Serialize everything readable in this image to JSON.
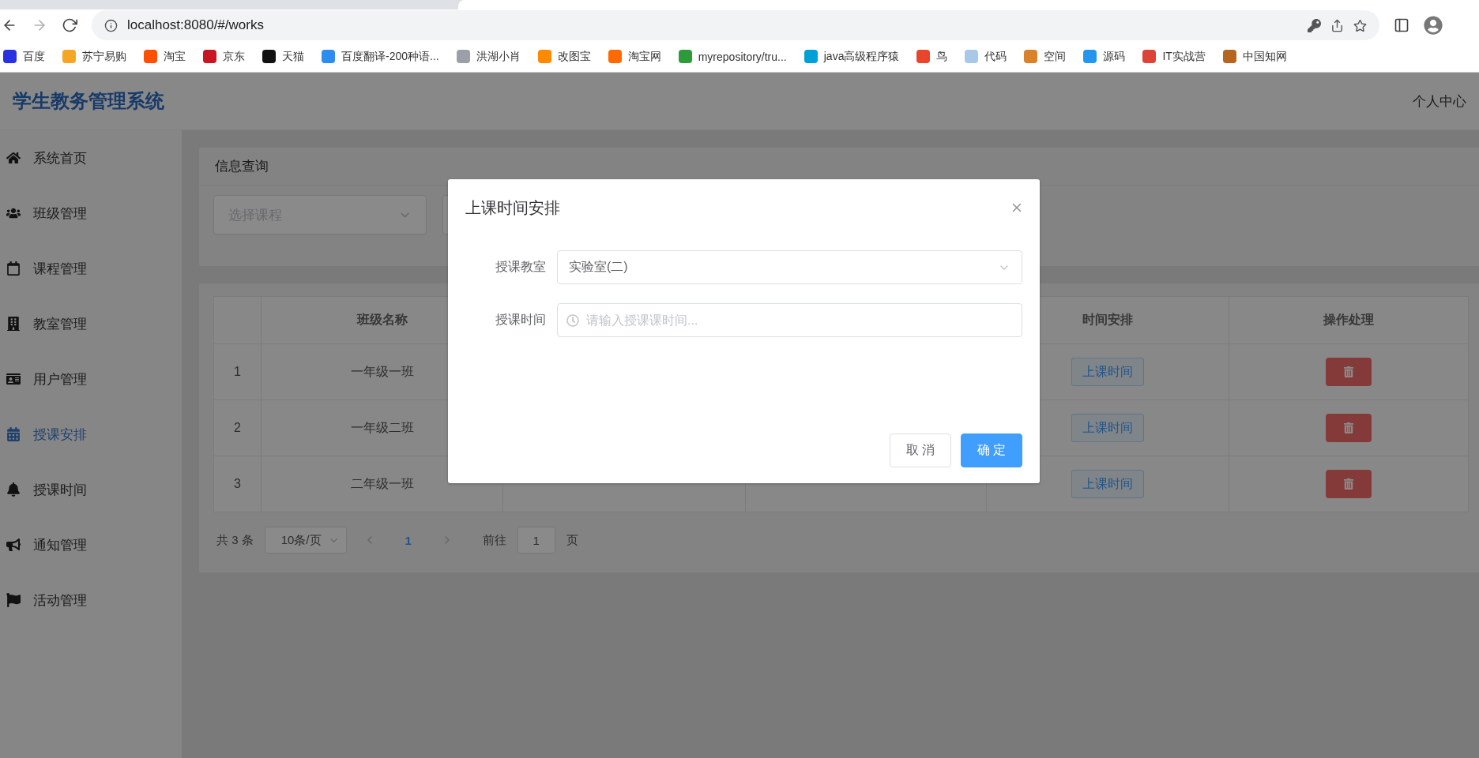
{
  "browser": {
    "url": "localhost:8080/#/works",
    "bookmarks": [
      {
        "label": "百度",
        "color": "#2932e1"
      },
      {
        "label": "苏宁易购",
        "color": "#f5a623"
      },
      {
        "label": "淘宝",
        "color": "#ff5000"
      },
      {
        "label": "京东",
        "color": "#c91623"
      },
      {
        "label": "天猫",
        "color": "#111111"
      },
      {
        "label": "百度翻译-200种语...",
        "color": "#2e8cf0"
      },
      {
        "label": "洪湖小肖",
        "color": "#9aa0a6"
      },
      {
        "label": "改图宝",
        "color": "#ff8a00"
      },
      {
        "label": "淘宝网",
        "color": "#ff6a00"
      },
      {
        "label": "myrepository/tru...",
        "color": "#2e9b3a"
      },
      {
        "label": "java高级程序猿",
        "color": "#00a1d6"
      },
      {
        "label": "鸟",
        "color": "#e8452c"
      },
      {
        "label": "代码",
        "color": "#a8c8e8"
      },
      {
        "label": "空间",
        "color": "#d9822b"
      },
      {
        "label": "源码",
        "color": "#2496ed"
      },
      {
        "label": "IT实战营",
        "color": "#db4437"
      },
      {
        "label": "中国知网",
        "color": "#b5651d"
      }
    ]
  },
  "app": {
    "title": "学生教务管理系统",
    "user_menu": "个人中心"
  },
  "sidebar": {
    "items": [
      {
        "label": "系统首页",
        "selected": false
      },
      {
        "label": "班级管理",
        "selected": false
      },
      {
        "label": "课程管理",
        "selected": false
      },
      {
        "label": "教室管理",
        "selected": false
      },
      {
        "label": "用户管理",
        "selected": false
      },
      {
        "label": "授课安排",
        "selected": true
      },
      {
        "label": "授课时间",
        "selected": false
      },
      {
        "label": "通知管理",
        "selected": false
      },
      {
        "label": "活动管理",
        "selected": false
      }
    ]
  },
  "query": {
    "title": "信息查询",
    "course_select": {
      "placeholder": "选择课程"
    }
  },
  "table": {
    "columns": [
      "班级名称",
      "时间安排",
      "操作处理"
    ],
    "rows": [
      {
        "index": "1",
        "class_name": "一年级一班",
        "time_button": "上课时间"
      },
      {
        "index": "2",
        "class_name": "一年级二班",
        "time_button": "上课时间"
      },
      {
        "index": "3",
        "class_name": "二年级一班",
        "time_button": "上课时间"
      }
    ]
  },
  "pagination": {
    "total": "共 3 条",
    "page_size": "10条/页",
    "pages": [
      {
        "label": "1",
        "selected": true
      }
    ],
    "goto_label": "前往",
    "goto_value": "1",
    "goto_suffix": "页"
  },
  "dialog": {
    "title": "上课时间安排",
    "fields": [
      {
        "kind": "select",
        "label": "授课教室",
        "value": "实验室(二)"
      },
      {
        "kind": "time",
        "label": "授课时间",
        "placeholder": "请输入授课课时间..."
      }
    ],
    "buttons": [
      {
        "kind": "default",
        "label": "取 消"
      },
      {
        "kind": "primary",
        "label": "确 定"
      }
    ]
  }
}
